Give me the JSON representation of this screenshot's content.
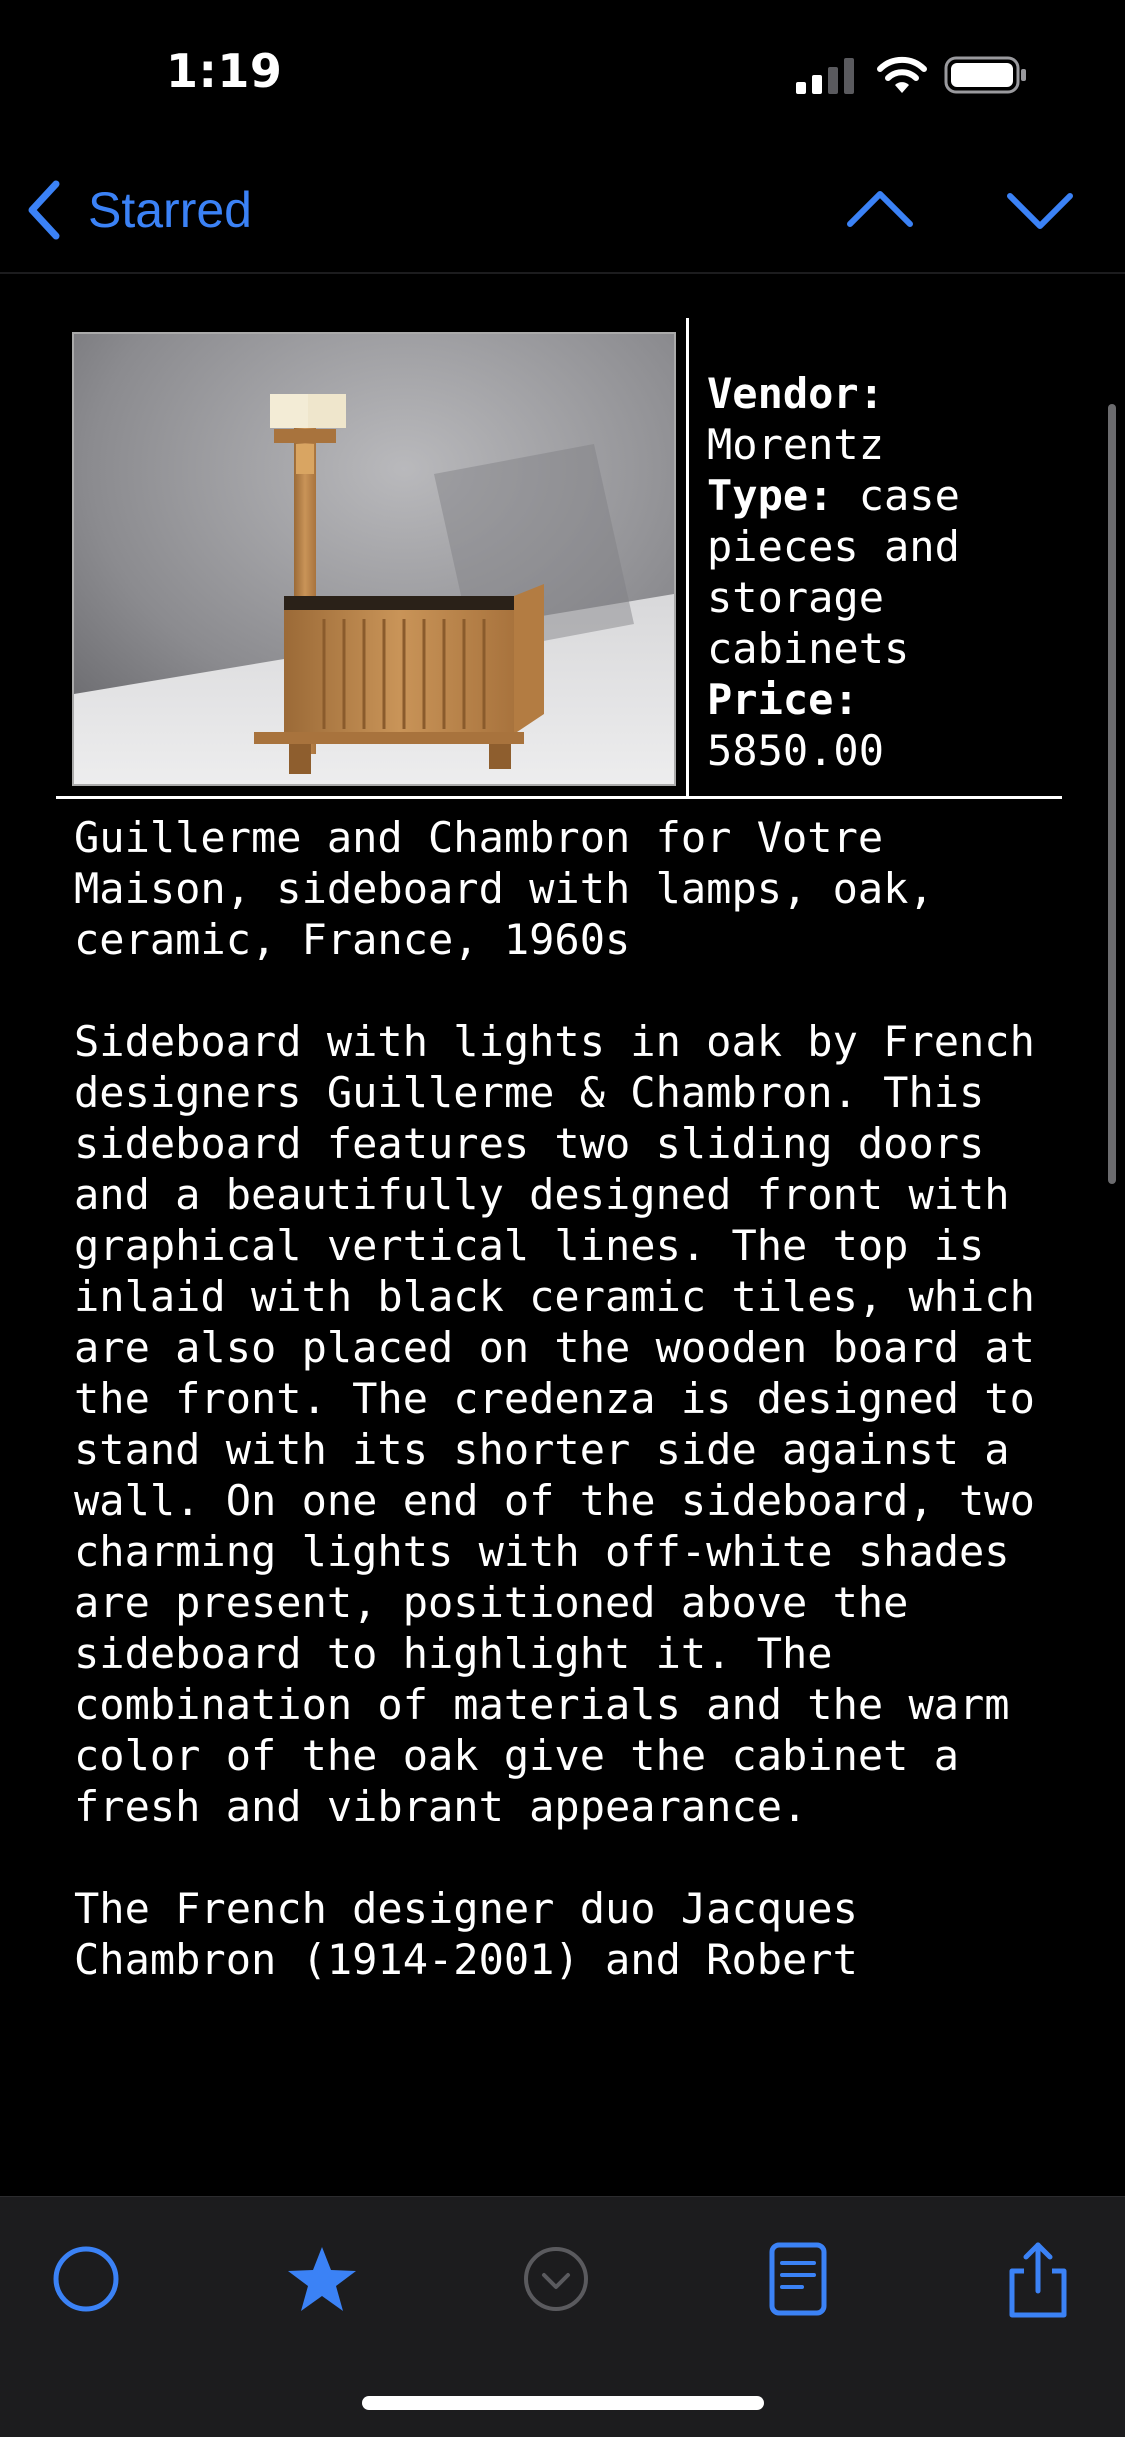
{
  "status_bar": {
    "time": "1:19"
  },
  "navbar": {
    "back_label": "Starred",
    "accent_color": "#3b82f6"
  },
  "product": {
    "image_alt": "Oak sideboard with two lamps",
    "vendor_label": "Vendor:",
    "vendor_value": "Morentz",
    "type_label": "Type:",
    "type_value": "case pieces and storage cabinets",
    "price_label": "Price:",
    "price_value": "5850.00"
  },
  "description": {
    "title": "Guillerme and Chambron for Votre Maison, sideboard with lamps, oak, ceramic, France, 1960s",
    "body": "Sideboard with lights in oak by French designers Guillerme & Chambron. This sideboard features two sliding doors and a beautifully designed front with graphical vertical lines. The top is inlaid with black ceramic tiles, which are also placed on the wooden board at the front. The credenza is designed to stand with its shorter side against a wall. On one end of the sideboard, two charming lights with off-white shades are present, positioned above the sideboard to highlight it. The combination of materials and the warm color of the oak give the cabinet a fresh and vibrant appearance.",
    "body2": "The French designer duo Jacques Chambron (1914-2001) and Robert"
  },
  "tabbar": {
    "items": [
      {
        "icon": "circle-icon",
        "state": "active"
      },
      {
        "icon": "star-icon",
        "state": "active"
      },
      {
        "icon": "checkmark-circle-icon",
        "state": "disabled"
      },
      {
        "icon": "document-icon",
        "state": "active"
      },
      {
        "icon": "share-icon",
        "state": "active"
      }
    ]
  }
}
